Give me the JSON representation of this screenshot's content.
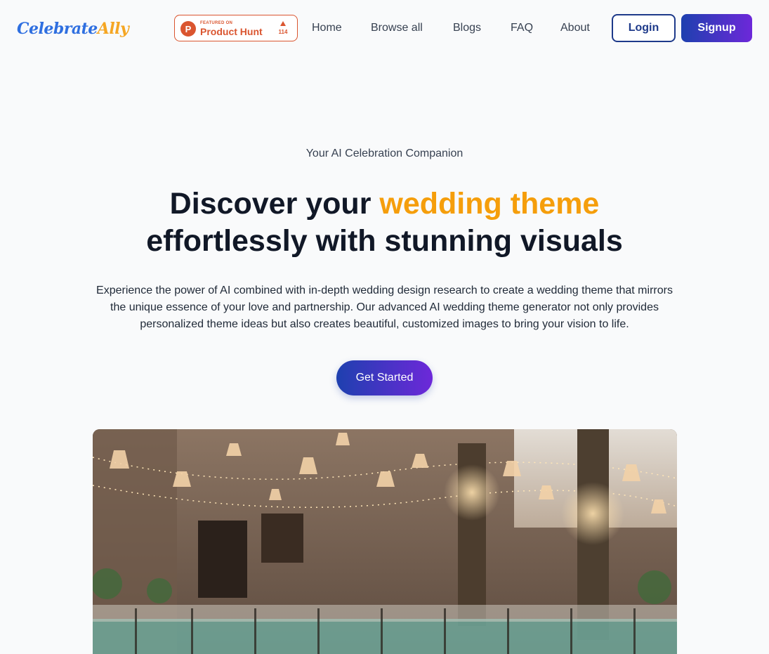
{
  "brand": {
    "logo_part1": "Celebrate",
    "logo_part2": "Ally",
    "colors": {
      "part1": "#2f6fe0",
      "part2": "#f5a623"
    }
  },
  "product_hunt": {
    "featured": "FEATURED ON",
    "name": "Product Hunt",
    "upvotes": "114",
    "icon": "P"
  },
  "nav": {
    "links": [
      "Home",
      "Browse all",
      "Blogs",
      "FAQ",
      "About"
    ],
    "login": "Login",
    "signup": "Signup"
  },
  "hero": {
    "tagline": "Your AI Celebration Companion",
    "headline_start": "Discover your ",
    "headline_accent": "wedding theme",
    "headline_end": "effortlessly with stunning visuals",
    "description": "Experience the power of AI combined with in-depth wedding design research to create a wedding theme that mirrors the unique essence of your love and partnership. Our advanced AI wedding theme generator not only provides personalized theme ideas but also creates beautiful, customized images to bring your vision to life.",
    "cta": "Get Started",
    "accent_color": "#f59e0b"
  }
}
